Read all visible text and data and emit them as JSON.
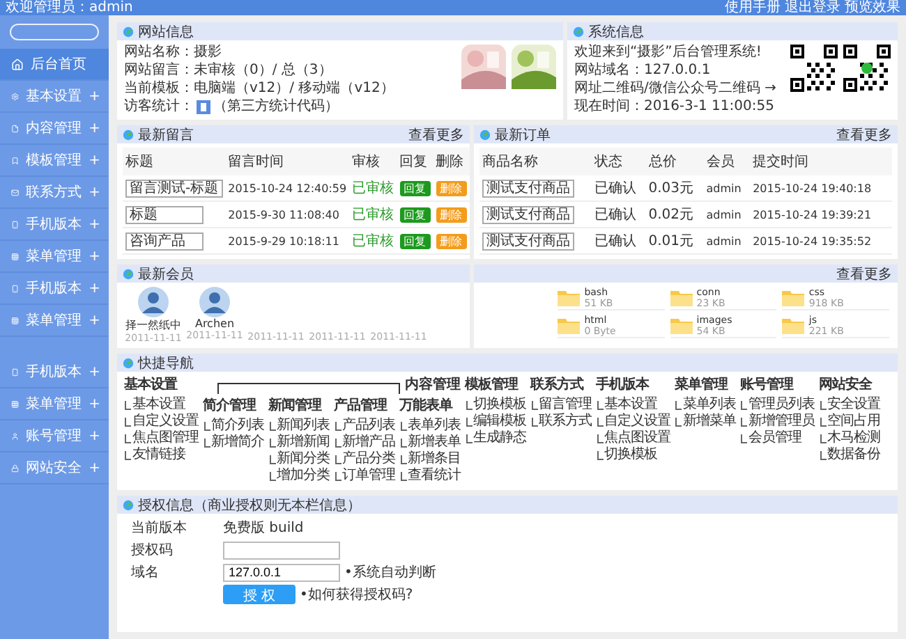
{
  "top_bar": {
    "greeting": "欢迎管理员：admin",
    "links": [
      "使用手册",
      "退出登录",
      "预览效果"
    ]
  },
  "sidebar": {
    "items": [
      {
        "label": "后台首页",
        "selected": true
      },
      {
        "label": "基本设置",
        "selected": false,
        "expander": "+"
      },
      {
        "label": "内容管理",
        "selected": false,
        "expander": "+"
      },
      {
        "label": "模板管理",
        "selected": false,
        "expander": "+"
      },
      {
        "label": "联系方式",
        "selected": false,
        "expander": "+"
      },
      {
        "label": "手机版本",
        "selected": false,
        "expander": "+"
      },
      {
        "label": "菜单管理",
        "selected": false,
        "expander": "+"
      },
      {
        "label": "手机版本",
        "selected": false,
        "expander": "+"
      },
      {
        "label": "菜单管理",
        "selected": false,
        "expander": "+"
      },
      {
        "label": "手机版本",
        "selected": false,
        "expander": "+"
      },
      {
        "label": "菜单管理",
        "selected": false,
        "expander": "+"
      },
      {
        "label": "账号管理",
        "selected": false,
        "expander": "+"
      },
      {
        "label": "网站安全",
        "selected": false,
        "expander": "+"
      }
    ]
  },
  "site_info": {
    "title": "网站信息",
    "lines": [
      "网站名称：摄影",
      "网站留言：未审核（0）/ 总（3）",
      "当前模板：电脑端（v12）/ 移动端（v12）"
    ],
    "visitor_label": "访客统计：",
    "visitor_note": "（第三方统计代码）"
  },
  "system_info": {
    "title": "系统信息",
    "lines": [
      "欢迎来到“摄影”后台管理系统!",
      "网站域名：127.0.0.1",
      "网址二维码/微信公众号二维码 →",
      "现在时间：2016-3-1 11:00:55"
    ]
  },
  "messages": {
    "title": "最新留言",
    "more": "查看更多",
    "columns": [
      "标题",
      "留言时间",
      "审核",
      "回复",
      "删除"
    ],
    "rows": [
      {
        "title": "留言测试-标题",
        "time": "2015-10-24 12:40:59",
        "status": "已审核",
        "reply": "回复",
        "delete": "删除"
      },
      {
        "title": "标题",
        "time": "2015-9-30 11:08:40",
        "status": "已审核",
        "reply": "回复",
        "delete": "删除"
      },
      {
        "title": "咨询产品",
        "time": "2015-9-29 10:18:11",
        "status": "已审核",
        "reply": "回复",
        "delete": "删除"
      }
    ]
  },
  "orders": {
    "title": "最新订单",
    "more": "查看更多",
    "columns": [
      "商品名称",
      "状态",
      "总价",
      "会员",
      "提交时间"
    ],
    "rows": [
      {
        "product": "测试支付商品",
        "status": "已确认",
        "price": "0.03元",
        "member": "admin",
        "time": "2015-10-24 19:40:18"
      },
      {
        "product": "测试支付商品",
        "status": "已确认",
        "price": "0.02元",
        "member": "admin",
        "time": "2015-10-24 19:39:21"
      },
      {
        "product": "测试支付商品",
        "status": "已确认",
        "price": "0.01元",
        "member": "admin",
        "time": "2015-10-24 19:35:52"
      }
    ]
  },
  "members": {
    "title": "最新会员",
    "items": [
      {
        "name": "择一然纸中",
        "date": "2011-11-11"
      },
      {
        "name": "Archen",
        "date": "2011-11-11"
      },
      {
        "date": "2011-11-11"
      },
      {
        "date": "2011-11-11"
      },
      {
        "date": "2011-11-11"
      }
    ]
  },
  "files": {
    "more": "查看更多",
    "items": [
      {
        "name": "bash",
        "size": "51 KB"
      },
      {
        "name": "conn",
        "size": "23 KB"
      },
      {
        "name": "css",
        "size": "918 KB"
      },
      {
        "name": "html",
        "size": "0 Byte"
      },
      {
        "name": "images",
        "size": "54 KB"
      },
      {
        "name": "js",
        "size": "221 KB"
      }
    ]
  },
  "quick_nav": {
    "title": "快捷导航",
    "group_label": "内容管理",
    "columns": [
      {
        "heading": "基本设置",
        "grouped": false,
        "items": [
          "基本设置",
          "自定义设置",
          "焦点图管理",
          "友情链接"
        ]
      },
      {
        "heading": "简介管理",
        "grouped": true,
        "items": [
          "简介列表",
          "新增简介"
        ]
      },
      {
        "heading": "新闻管理",
        "grouped": true,
        "items": [
          "新闻列表",
          "新增新闻",
          "新闻分类",
          "增加分类"
        ]
      },
      {
        "heading": "产品管理",
        "grouped": true,
        "items": [
          "产品列表",
          "新增产品",
          "产品分类",
          "订单管理"
        ]
      },
      {
        "heading": "万能表单",
        "grouped": true,
        "items": [
          "表单列表",
          "新增表单",
          "新增条目",
          "查看统计"
        ]
      },
      {
        "heading": "模板管理",
        "grouped": false,
        "items": [
          "切换模板",
          "编辑模板",
          "生成静态"
        ]
      },
      {
        "heading": "联系方式",
        "grouped": false,
        "items": [
          "留言管理",
          "联系方式"
        ]
      },
      {
        "heading": "手机版本",
        "grouped": false,
        "items": [
          "基本设置",
          "自定义设置",
          "焦点图设置",
          "切换模板"
        ]
      },
      {
        "heading": "菜单管理",
        "grouped": false,
        "items": [
          "菜单列表",
          "新增菜单"
        ]
      },
      {
        "heading": "账号管理",
        "grouped": false,
        "items": [
          "管理员列表",
          "新增管理员",
          "会员管理"
        ]
      },
      {
        "heading": "网站安全",
        "grouped": false,
        "items": [
          "安全设置",
          "空间占用",
          "木马检测",
          "数据备份"
        ]
      }
    ]
  },
  "license": {
    "title": "授权信息（商业授权则无本栏信息）",
    "version_label": "当前版本",
    "version": "免费版 build",
    "code_label": "授权码",
    "domain_label": "域名",
    "domain": "127.0.0.1",
    "domain_hint": "•系统自动判断",
    "button": "授 权",
    "help_link": "•如何获得授权码?"
  }
}
